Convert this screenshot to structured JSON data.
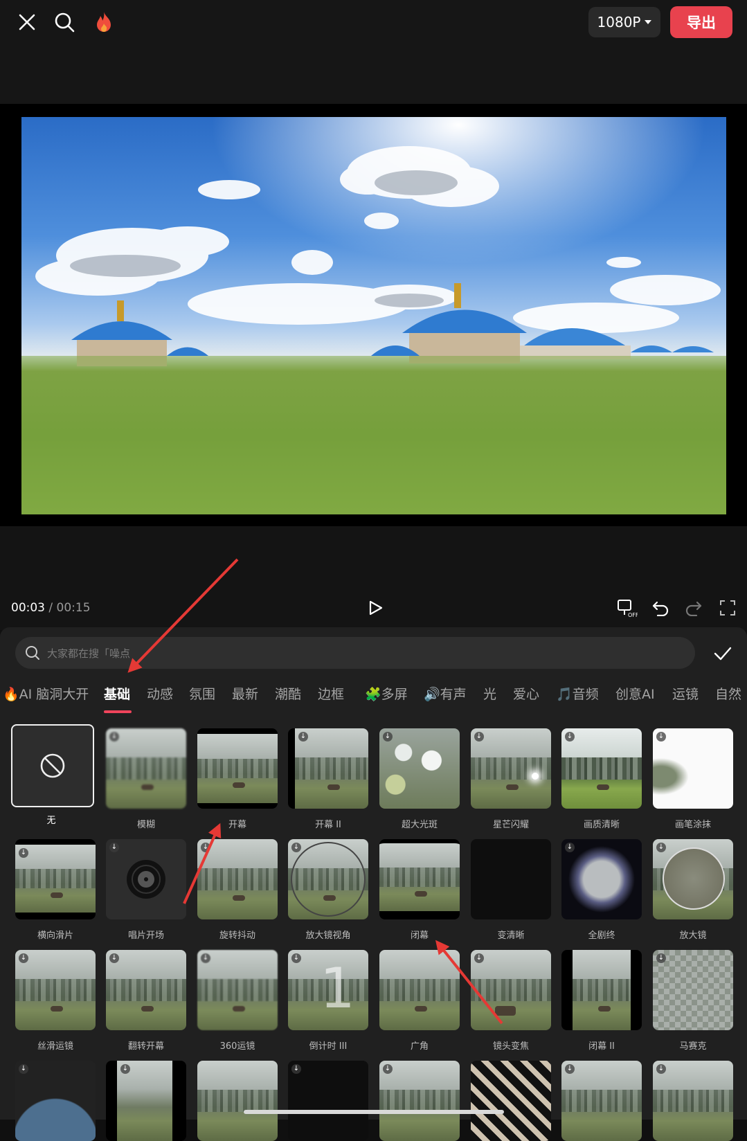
{
  "colors": {
    "accent": "#e8424e",
    "tab_active": "#ffffff",
    "underline": "#f0445b"
  },
  "topbar": {
    "close_icon": "close-icon",
    "search_icon": "search-icon",
    "hot_icon": "flame-icon",
    "resolution": "1080P",
    "export_label": "导出"
  },
  "player": {
    "current_time": "00:03",
    "separator": " / ",
    "total_time": "00:15"
  },
  "search": {
    "placeholder": "大家都在搜「噪点"
  },
  "tabs": [
    "🔥AI 脑洞大开",
    "基础",
    "动感",
    "氛围",
    "最新",
    "潮酷",
    "边框",
    "🧩多屏",
    "🔊有声",
    "光",
    "爱心",
    "🎵音频",
    "创意AI",
    "运镜",
    "自然"
  ],
  "active_tab": "基础",
  "effects": [
    {
      "label": "无"
    },
    {
      "label": "模糊"
    },
    {
      "label": "开幕"
    },
    {
      "label": "开幕 II"
    },
    {
      "label": "超大光斑"
    },
    {
      "label": "星芒闪耀"
    },
    {
      "label": "画质清晰"
    },
    {
      "label": "画笔涂抹"
    },
    {
      "label": "横向滑片"
    },
    {
      "label": "唱片开场"
    },
    {
      "label": "旋转抖动"
    },
    {
      "label": "放大镜视角"
    },
    {
      "label": "闭幕"
    },
    {
      "label": "变清晰"
    },
    {
      "label": "全剧终"
    },
    {
      "label": "放大镜"
    },
    {
      "label": "丝滑运镜"
    },
    {
      "label": "翻转开幕"
    },
    {
      "label": "360运镜"
    },
    {
      "label": "倒计时 III"
    },
    {
      "label": "广角"
    },
    {
      "label": "镜头变焦"
    },
    {
      "label": "闭幕 II"
    },
    {
      "label": "马赛克"
    }
  ]
}
